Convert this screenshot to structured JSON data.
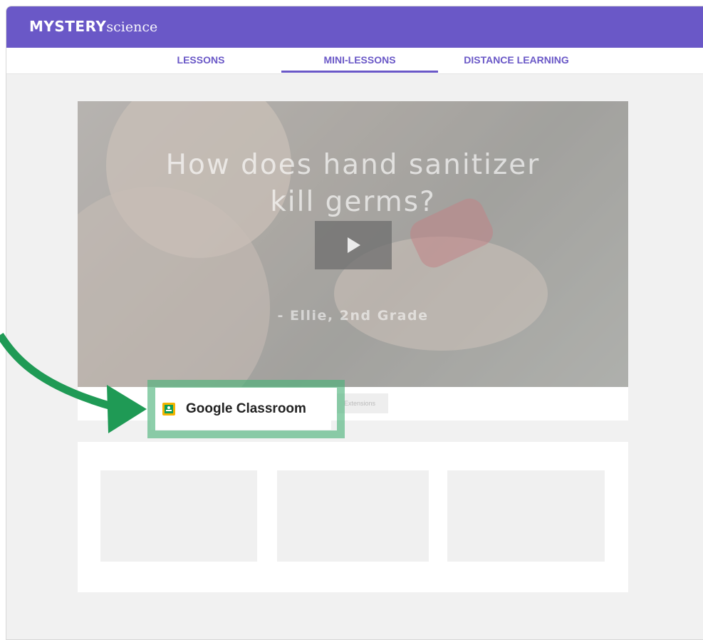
{
  "header": {
    "logo_bold": "MYSTERY",
    "logo_light": "science",
    "brand_color": "#6a58c7"
  },
  "nav": {
    "tabs": [
      {
        "label": "LESSONS",
        "active": false
      },
      {
        "label": "MINI-LESSONS",
        "active": true
      },
      {
        "label": "DISTANCE LEARNING",
        "active": false
      }
    ]
  },
  "video": {
    "title_line1": "How does hand sanitizer",
    "title_line2": "kill germs?",
    "byline": "- Ellie, 2nd Grade",
    "play_icon": "play-icon"
  },
  "actions": {
    "google_classroom_label": "Google Classroom",
    "google_classroom_icon": "google-classroom-icon",
    "extensions_label": "Extensions"
  },
  "annotation": {
    "arrow_color": "#1f9a55",
    "highlight_color": "#48b278"
  }
}
